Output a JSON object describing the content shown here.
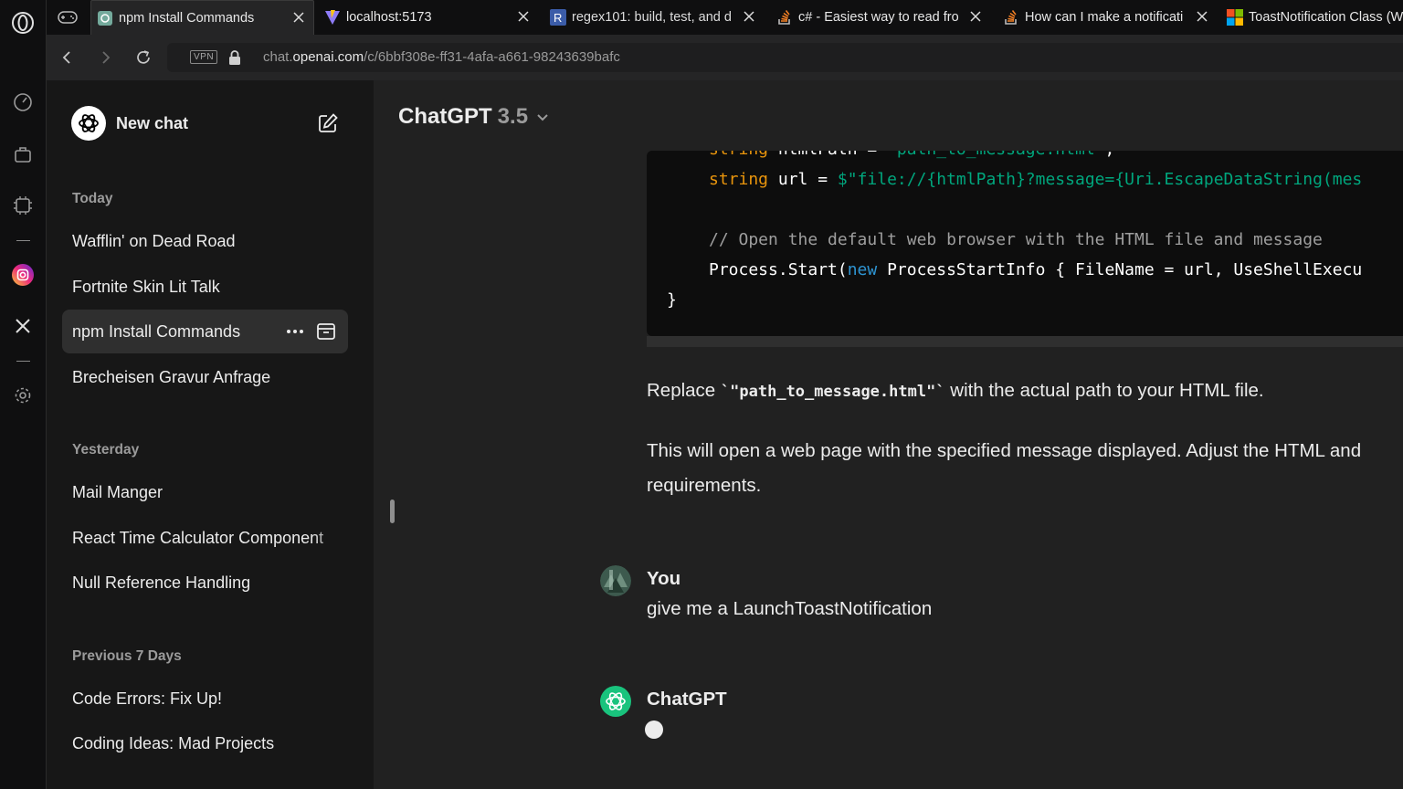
{
  "browser": {
    "tabs": [
      {
        "title": "npm Install Commands",
        "favicon": "chatgpt-icon",
        "active": true
      },
      {
        "title": "localhost:5173",
        "favicon": "vite-icon",
        "active": false
      },
      {
        "title": "regex101: build, test, and d",
        "favicon": "regex101-icon",
        "active": false
      },
      {
        "title": "c# - Easiest way to read fro",
        "favicon": "stackoverflow-icon",
        "active": false
      },
      {
        "title": "How can I make a notificati",
        "favicon": "stackoverflow-icon",
        "active": false
      },
      {
        "title": "ToastNotification Class (W",
        "favicon": "microsoft-icon",
        "active": false
      }
    ],
    "address": {
      "vpn_label": "VPN",
      "url_prefix": "chat.",
      "url_domain": "openai.com",
      "url_path": "/c/6bbf308e-ff31-4afa-a661-98243639bafc"
    }
  },
  "sidebar": {
    "new_chat_label": "New chat",
    "groups": [
      {
        "label": "Today",
        "items": [
          "Wafflin' on Dead Road",
          "Fortnite Skin Lit Talk",
          "npm Install Commands",
          "Brecheisen Gravur Anfrage"
        ]
      },
      {
        "label": "Yesterday",
        "items": [
          "Mail Manger",
          "React Time Calculator Component",
          "Null Reference Handling"
        ]
      },
      {
        "label": "Previous 7 Days",
        "items": [
          "Code Errors: Fix Up!",
          "Coding Ideas: Mad Projects"
        ]
      }
    ],
    "selected_item": "npm Install Commands"
  },
  "main": {
    "model_name": "ChatGPT",
    "model_version": "3.5",
    "code_lines": {
      "l0_kw": "string",
      "l0_rest": " htmlPath = ",
      "l0_str": "\"path_to_message.html\"",
      "l0_end": ";",
      "l1_kw": "string",
      "l1_rest": " url = ",
      "l1_str": "$\"file://{htmlPath}?message={Uri.EscapeDataString(mes",
      "l3_comment": "// Open the default web browser with the HTML file and message",
      "l4_a": "Process.Start(",
      "l4_new": "new",
      "l4_b": " ProcessStartInfo { FileName = url, UseShellExecu",
      "l5": "}"
    },
    "replace_text_a": "Replace ",
    "replace_code": "`\"path_to_message.html\"`",
    "replace_text_b": " with the actual path to your HTML file.",
    "para2_line1": "This will open a web page with the specified message displayed. Adjust the HTML and",
    "para2_line2": "requirements.",
    "user_author": "You",
    "user_message": "give me a LaunchToastNotification",
    "assistant_author": "ChatGPT"
  },
  "colors": {
    "sidebar_bg": "#171717",
    "main_bg": "#212121",
    "code_bg": "#0d0d0d",
    "keyword": "#e9950c",
    "string": "#00a67d",
    "assistant_avatar": "#19c37d"
  }
}
